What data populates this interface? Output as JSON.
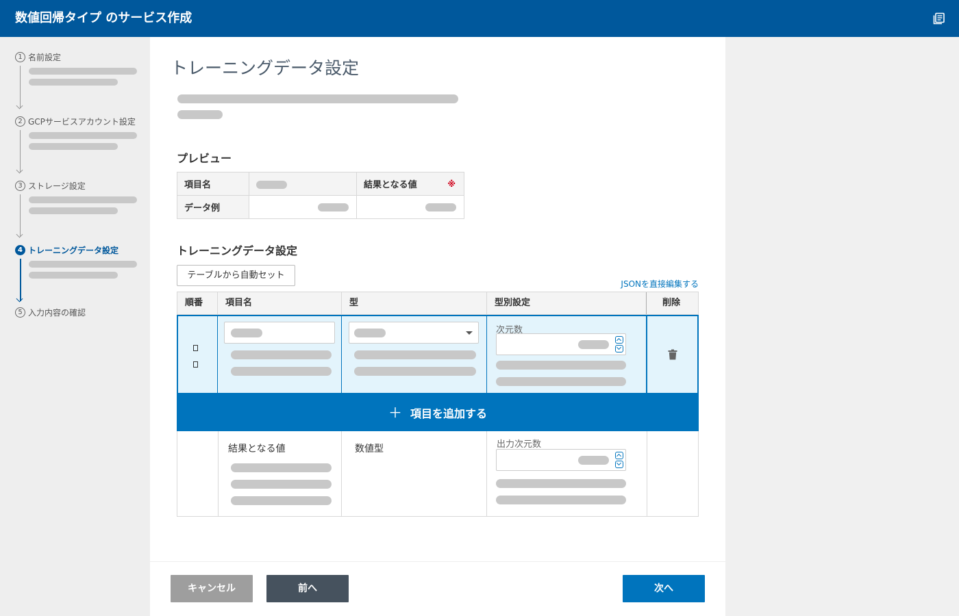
{
  "header": {
    "title": "数値回帰タイプ のサービス作成",
    "doc_icon": "document-list-icon"
  },
  "steps": [
    {
      "num": "1",
      "label": "名前設定",
      "active": false
    },
    {
      "num": "2",
      "label": "GCPサービスアカウント設定",
      "active": false
    },
    {
      "num": "3",
      "label": "ストレージ設定",
      "active": false
    },
    {
      "num": "4",
      "label": "トレーニングデータ設定",
      "active": true
    },
    {
      "num": "5",
      "label": "入力内容の確認",
      "active": false
    }
  ],
  "page": {
    "title": "トレーニングデータ設定"
  },
  "preview": {
    "title": "プレビュー",
    "row1_label": "項目名",
    "row2_label": "データ例",
    "result_label": "結果となる値",
    "required_mark": "※"
  },
  "training": {
    "title": "トレーニングデータ設定",
    "auto_set_button": "テーブルから自動セット",
    "json_link": "JSONを直接編集する",
    "columns": {
      "order": "順番",
      "name": "項目名",
      "type": "型",
      "type_setting": "型別設定",
      "delete": "削除"
    },
    "row": {
      "dimension_label": "次元数"
    },
    "add_item": "項目を追加する",
    "output_row": {
      "name": "結果となる値",
      "type": "数値型",
      "dimension_label": "出力次元数"
    }
  },
  "footer": {
    "cancel": "キャンセル",
    "prev": "前へ",
    "next": "次へ"
  },
  "colors": {
    "header": "#00589c",
    "accent": "#0074bd",
    "selected_row": "#e3f4fc",
    "prev_button": "#46525e",
    "cancel_button": "#9e9e9e"
  }
}
